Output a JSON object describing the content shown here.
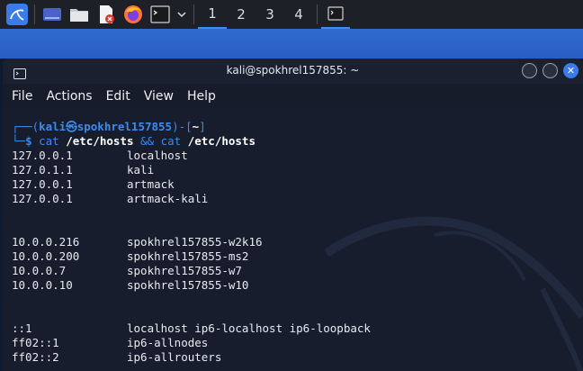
{
  "taskbar": {
    "workspaces": [
      "1",
      "2",
      "3",
      "4"
    ],
    "icons": [
      "kali-menu-icon",
      "desktop-icon",
      "file-manager-icon",
      "text-editor-icon",
      "firefox-icon",
      "terminal-icon",
      "chevron-down-icon",
      "terminal-task-icon"
    ]
  },
  "window": {
    "title": "kali@spokhrel157855: ~",
    "menu": [
      "File",
      "Actions",
      "Edit",
      "View",
      "Help"
    ]
  },
  "terminal": {
    "prompt": {
      "open": "┌──(",
      "user_host": "kali㉿spokhrel157855",
      "mid": ")-[",
      "dir": "~",
      "close": "]",
      "arrow": "└─",
      "dollar": "$ ",
      "cmd1": "cat",
      "arg1": " /etc/hosts ",
      "op": "&&",
      "cmd2": " cat",
      "arg2": " /etc/hosts"
    },
    "hosts_1": [
      {
        "ip": "127.0.0.1",
        "name": "localhost"
      },
      {
        "ip": "127.0.1.1",
        "name": "kali"
      },
      {
        "ip": "127.0.0.1",
        "name": "artmack"
      },
      {
        "ip": "127.0.0.1",
        "name": "artmack-kali"
      }
    ],
    "hosts_2": [
      {
        "ip": "10.0.0.216",
        "name": "spokhrel157855-w2k16"
      },
      {
        "ip": "10.0.0.200",
        "name": "spokhrel157855-ms2"
      },
      {
        "ip": "10.0.0.7",
        "name": "spokhrel157855-w7"
      },
      {
        "ip": "10.0.0.10",
        "name": "spokhrel157855-w10"
      }
    ],
    "hosts_3": [
      {
        "ip": "::1",
        "name": "localhost ip6-localhost ip6-loopback"
      },
      {
        "ip": "ff02::1",
        "name": "ip6-allnodes"
      },
      {
        "ip": "ff02::2",
        "name": "ip6-allrouters"
      }
    ]
  },
  "colors": {
    "accent": "#3b8bf0",
    "taskbar": "#1e2028",
    "terminal_bg": "#171d2c"
  }
}
